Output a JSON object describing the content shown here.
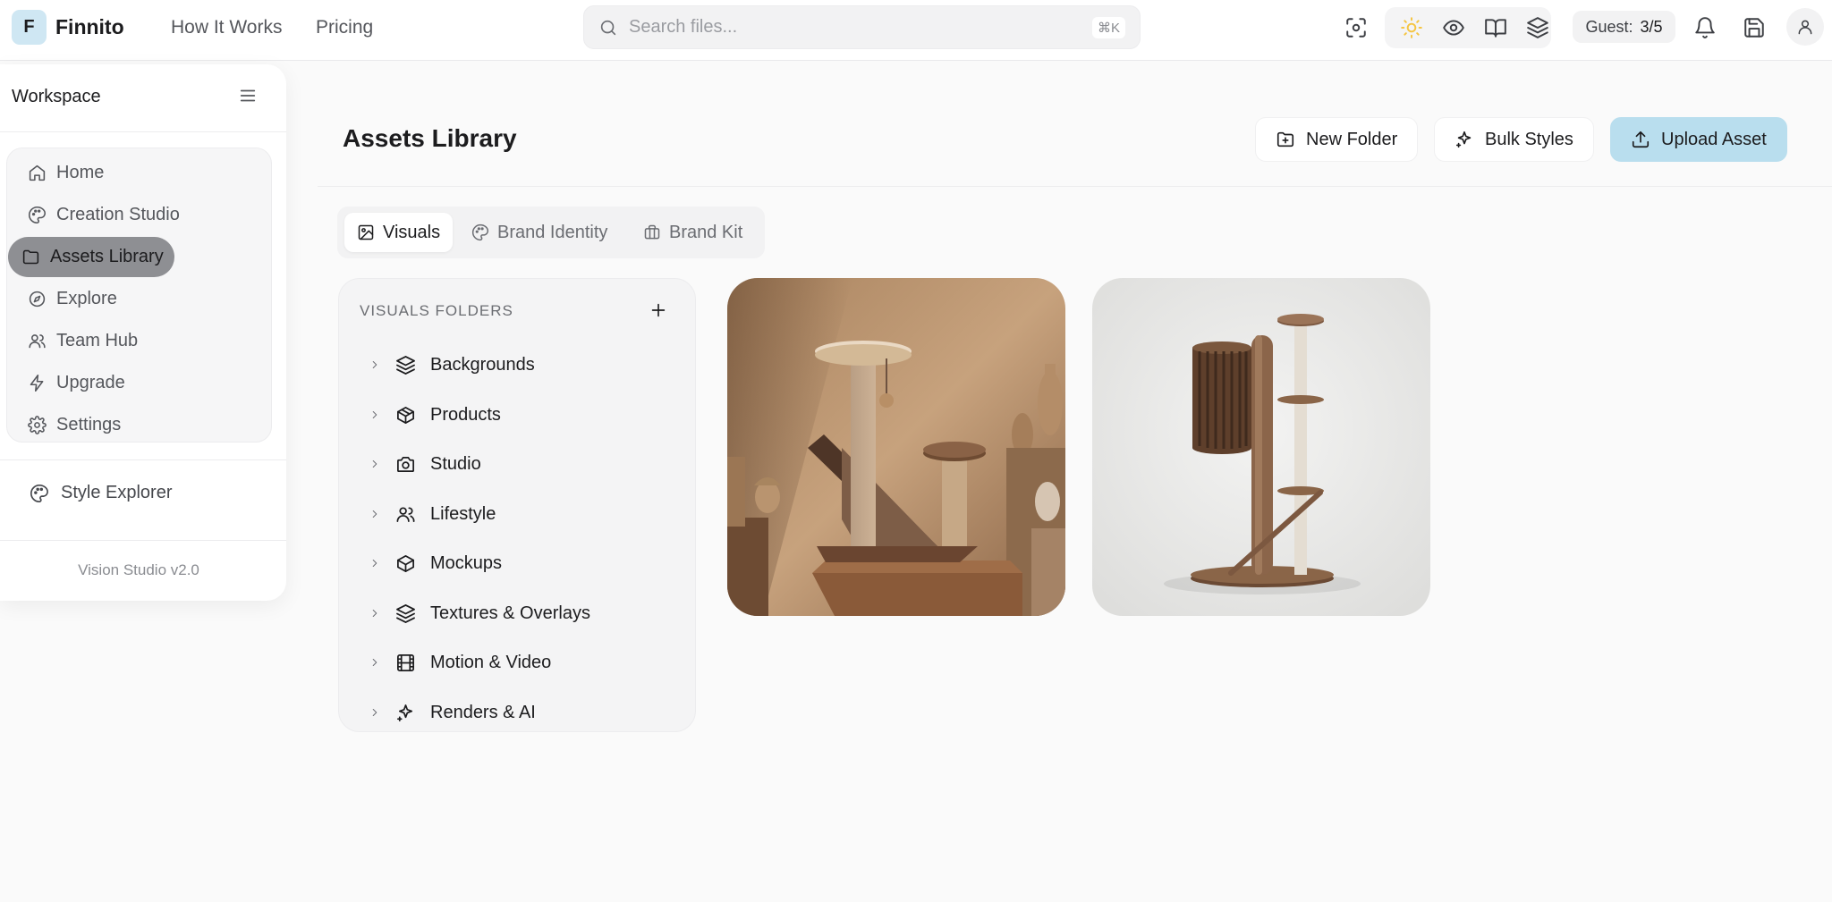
{
  "app": {
    "logo_letter": "F",
    "name": "Finnito"
  },
  "topnav": [
    {
      "label": "How It Works"
    },
    {
      "label": "Pricing"
    }
  ],
  "search": {
    "placeholder": "Search files...",
    "shortcut": "⌘K"
  },
  "toolbar": {
    "icons": [
      "focus-scan-icon",
      "sun-icon",
      "eye-icon",
      "book-open-icon",
      "layers-icon"
    ],
    "sun_color": "#f5c542",
    "guest_label": "Guest:",
    "guest_count": "3/5",
    "right_icons": [
      "bell-icon",
      "save-icon",
      "user-icon"
    ]
  },
  "sidebar": {
    "title": "Workspace",
    "items": [
      {
        "label": "Home",
        "icon": "home-icon"
      },
      {
        "label": "Creation Studio",
        "icon": "palette-icon"
      },
      {
        "label": "Assets Library",
        "icon": "folder-icon",
        "active": true
      },
      {
        "label": "Explore",
        "icon": "compass-icon"
      },
      {
        "label": "Team Hub",
        "icon": "users-icon"
      },
      {
        "label": "Upgrade",
        "icon": "zap-icon"
      },
      {
        "label": "Settings",
        "icon": "settings-icon"
      }
    ],
    "style_explorer": "Style Explorer",
    "version": "Vision Studio v2.0"
  },
  "main": {
    "title": "Assets Library",
    "buttons": {
      "new_folder": "New Folder",
      "bulk_styles": "Bulk Styles",
      "upload_asset": "Upload Asset"
    },
    "accent_color": "#b9deee",
    "tabs": [
      {
        "label": "Visuals",
        "active": true
      },
      {
        "label": "Brand Identity"
      },
      {
        "label": "Brand Kit"
      }
    ],
    "folders": {
      "title": "VISUALS FOLDERS",
      "items": [
        {
          "label": "Backgrounds",
          "icon": "layers-icon"
        },
        {
          "label": "Products",
          "icon": "package-icon"
        },
        {
          "label": "Studio",
          "icon": "camera-icon"
        },
        {
          "label": "Lifestyle",
          "icon": "users-icon"
        },
        {
          "label": "Mockups",
          "icon": "box-icon"
        },
        {
          "label": "Textures & Overlays",
          "icon": "layers-icon"
        },
        {
          "label": "Motion & Video",
          "icon": "film-icon"
        },
        {
          "label": "Renders & AI",
          "icon": "sparkles-icon"
        }
      ]
    },
    "assets": [
      {
        "name": "cat-tree-warm-scene"
      },
      {
        "name": "cat-tree-white-studio"
      }
    ]
  }
}
